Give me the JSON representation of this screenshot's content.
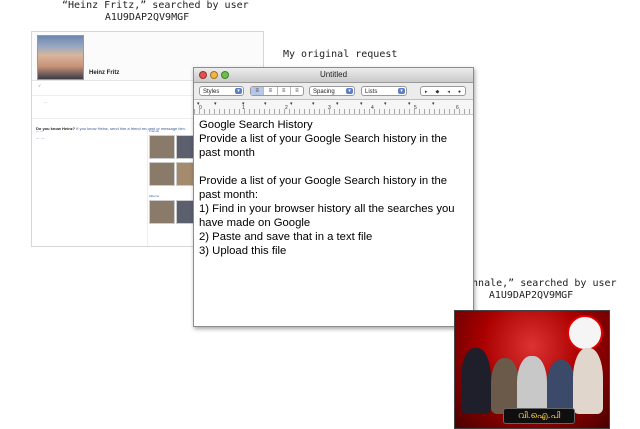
{
  "captions": {
    "heinz_line1": "“Heinz Fritz,” searched by user",
    "heinz_line2": "A1U9DAP2QV9MGF",
    "original_request": "My original request",
    "innale_line1": "“Innale,” searched by user",
    "innale_line2": "A1U9DAP2QV9MGF"
  },
  "facebook": {
    "name": "Heinz Fritz",
    "question_bold": "Do you know Heinz?",
    "question_rest": " If you know Heinz, send him a friend request or message him.",
    "section_friends": "Friends",
    "section_albums": "Albums"
  },
  "textedit": {
    "window_title": "Untitled",
    "toolbar": {
      "styles": "Styles",
      "spacing": "Spacing",
      "lists": "Lists"
    },
    "ruler_numbers": [
      "0",
      "1",
      "2",
      "3",
      "4",
      "5",
      "6"
    ],
    "document": {
      "heading": "Google Search History",
      "para1": "Provide a list of your Google Search history in the past month",
      "para2_line1": "Provide a list of your Google Search history in the past month:",
      "step1": "1) Find in your browser history all the searches you have made on Google",
      "step2": "2) Paste and save that in a text file",
      "step3": "3) Upload this file"
    }
  },
  "innale_photo": {
    "banner_text": "വി.ഐ.പി"
  },
  "colors": {
    "facebook_link": "#3b5998",
    "traffic_close": "#e5514b",
    "traffic_min": "#f2b542",
    "traffic_max": "#6ac04a",
    "stage_red": "#a00000"
  }
}
